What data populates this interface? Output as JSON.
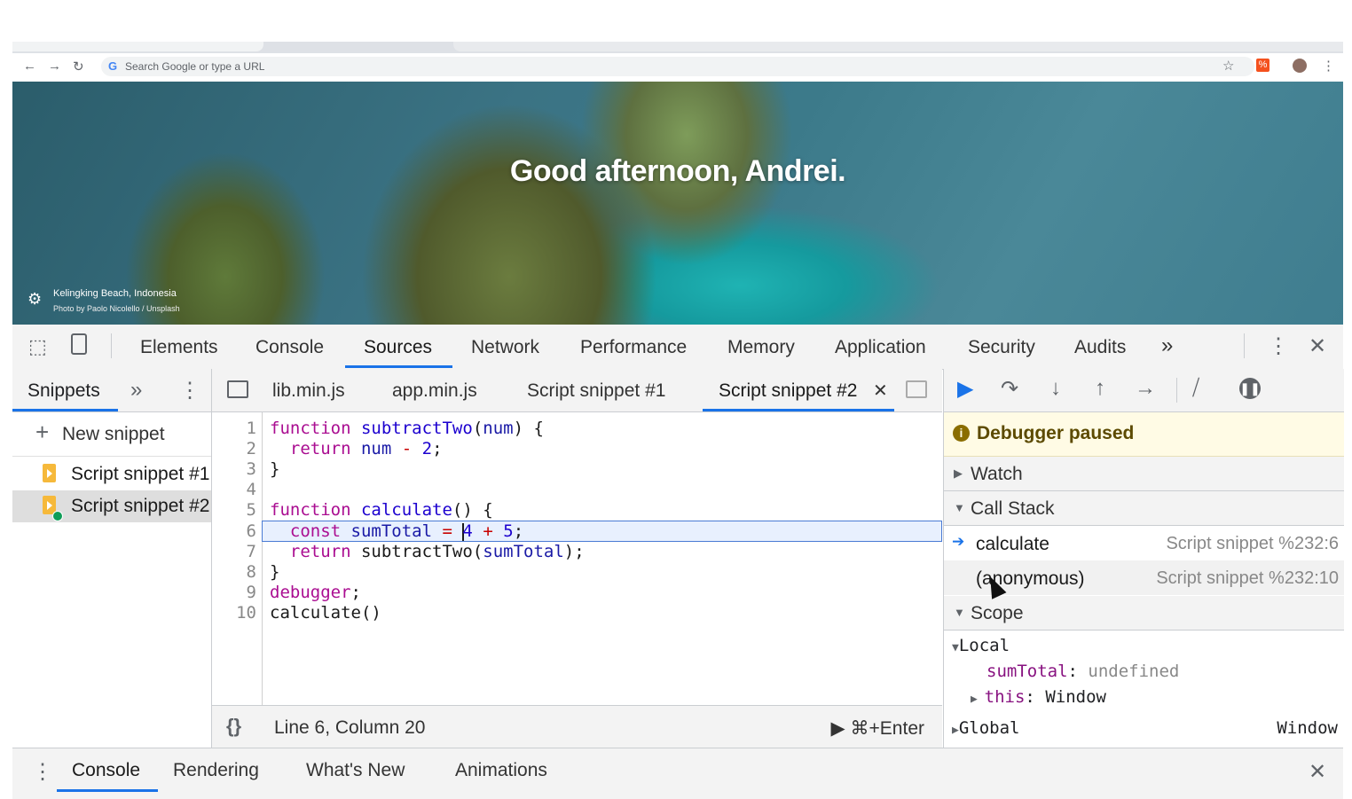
{
  "browser": {
    "omnibox_placeholder": "Search Google or type a URL",
    "extension_badge": "%"
  },
  "hero": {
    "greeting": "Good afternoon, Andrei.",
    "location": "Kelingking Beach, Indonesia",
    "credit": "Photo by Paolo Nicolello / Unsplash"
  },
  "devtools": {
    "tabs": [
      "Elements",
      "Console",
      "Sources",
      "Network",
      "Performance",
      "Memory",
      "Application",
      "Security",
      "Audits"
    ],
    "active_tab": "Sources",
    "more_tabs": "»",
    "close": "✕"
  },
  "navigator": {
    "tab_label": "Snippets",
    "more": "»",
    "new_snippet_label": "New snippet",
    "snippets": [
      "Script snippet #1",
      "Script snippet #2"
    ]
  },
  "editor": {
    "tabs": [
      "lib.min.js",
      "app.min.js",
      "Script snippet #1",
      "Script snippet #2"
    ],
    "active_tab": "Script snippet #2",
    "line_numbers": [
      "1",
      "2",
      "3",
      "4",
      "5",
      "6",
      "7",
      "8",
      "9",
      "10"
    ],
    "status_position": "Line 6, Column 20",
    "run_hint": "⌘+Enter"
  },
  "debugger": {
    "paused_label": "Debugger paused",
    "watch_label": "Watch",
    "call_stack_label": "Call Stack",
    "frames": [
      {
        "name": "calculate",
        "location": "Script snippet %232:6"
      },
      {
        "name": "(anonymous)",
        "location": "Script snippet %232:10"
      }
    ],
    "scope_label": "Scope",
    "local_label": "Local",
    "local_vars": [
      {
        "key": "sumTotal",
        "value": "undefined"
      },
      {
        "key": "this",
        "value": "Window"
      }
    ],
    "global_label": "Global",
    "global_value": "Window"
  },
  "drawer": {
    "tabs": [
      "Console",
      "Rendering",
      "What's New",
      "Animations"
    ],
    "active_tab": "Console"
  },
  "colors": {
    "accent": "#1a73e8",
    "paused_bg": "#fffbe5",
    "keyword": "#aa0d91",
    "snippet_icon": "#f6b93b"
  }
}
